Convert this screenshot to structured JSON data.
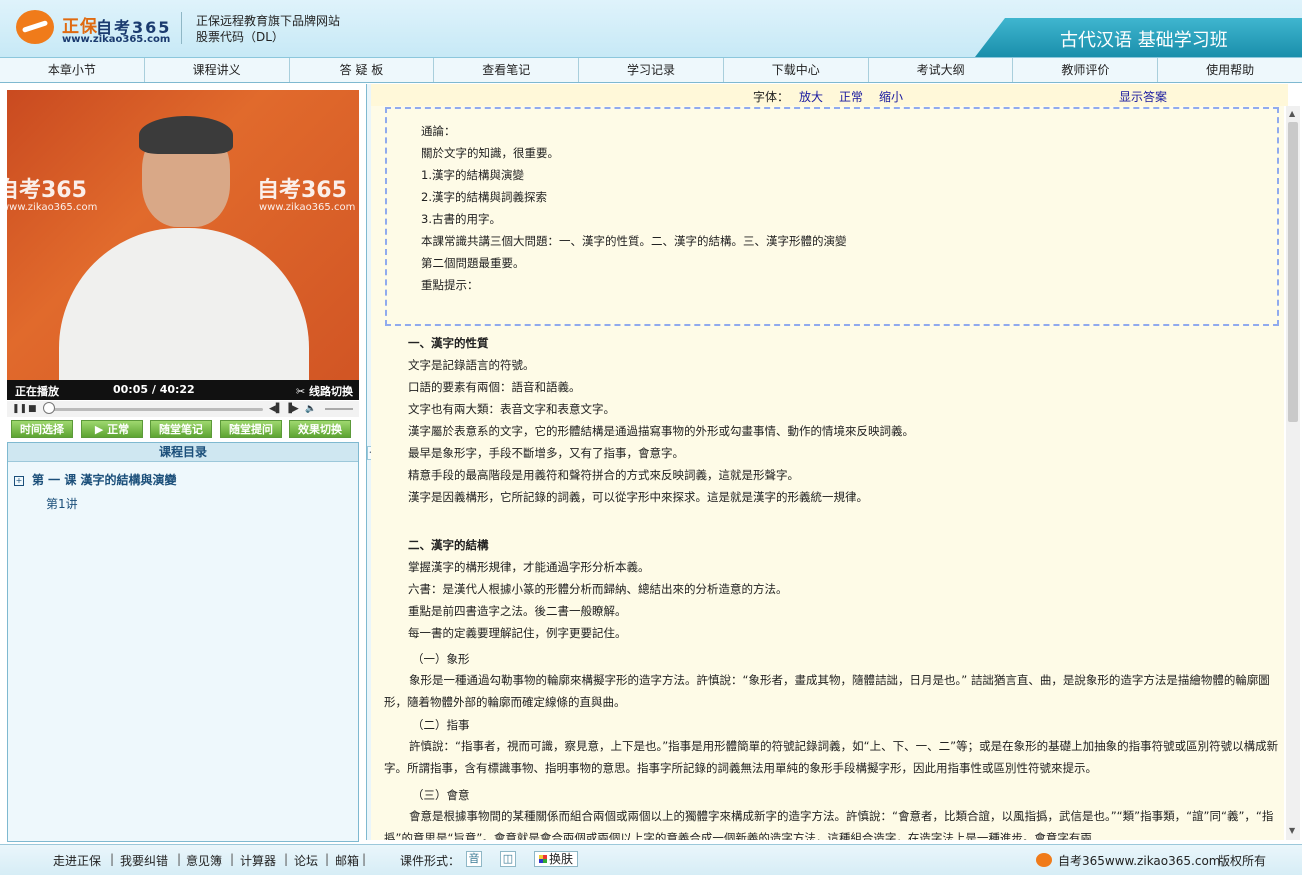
{
  "header": {
    "logo_cn": "正保",
    "logo_num": "自考365",
    "logo_url": "www.zikao365.com",
    "brand_line1": "正保远程教育旗下品牌网站",
    "brand_line2": "股票代码（DL）",
    "course_title": "古代汉语 基础学习班"
  },
  "nav": [
    "本章小节",
    "课程讲义",
    "答 疑 板",
    "查看笔记",
    "学习记录",
    "下载中心",
    "考试大纲",
    "教师评价",
    "使用帮助"
  ],
  "video": {
    "watermark": "自考365",
    "watermark_url": "www.zikao365.com",
    "status": "正在播放",
    "time": "00:05 / 40:22",
    "switch_line": "线路切换",
    "progress": 0.002
  },
  "func_buttons": [
    "时间选择",
    "▶ 正常",
    "随堂笔记",
    "随堂提问",
    "效果切换"
  ],
  "catalog": {
    "title": "课程目录",
    "lesson_toggle": "+",
    "lesson": "第 一 课 漢字的結構與演變",
    "item": "第1讲"
  },
  "content_top": {
    "font_label": "字体：",
    "enlarge": "放大",
    "normal": "正常",
    "shrink": "缩小",
    "show_answer": "显示答案"
  },
  "notes": [
    "通論：",
    "關於文字的知識，很重要。",
    "1.漢字的結構與演變",
    "2.漢字的結構與詞義探索",
    "3.古書的用字。",
    "本課常識共講三個大問題：一、漢字的性質。二、漢字的結構。三、漢字形體的演變",
    "第二個問題最重要。",
    "重點提示："
  ],
  "section1": {
    "heading": "一、漢字的性質",
    "lines": [
      "文字是記錄語言的符號。",
      "口語的要素有兩個：語音和語義。",
      "文字也有兩大類：表音文字和表意文字。",
      "漢字屬於表意系的文字，它的形體結構是通過描寫事物的外形或勾畫事情、動作的情境來反映詞義。",
      "最早是象形字，手段不斷增多，又有了指事，會意字。",
      "精意手段的最高階段是用義符和聲符拼合的方式來反映詞義，這就是形聲字。",
      "漢字是因義構形，它所記錄的詞義，可以從字形中來探求。這是就是漢字的形義統一規律。"
    ]
  },
  "section2": {
    "heading": "二、漢字的結構",
    "lines": [
      "掌握漢字的構形規律，才能通過字形分析本義。",
      "六書：是漢代人根據小篆的形體分析而歸納、總結出來的分析造意的方法。",
      "重點是前四書造字之法。後二書一般瞭解。",
      "每一書的定義要理解記住，例字更要記住。"
    ],
    "sub1": "（一）象形",
    "para1": "象形是一種通過勾勒事物的輪廓來構擬字形的造字方法。許慎說：“象形者，畫成其物，隨體詰詘，日月是也。” 詰詘猶言直、曲，是說象形的造字方法是描繪物體的輪廓圖形，隨着物體外部的輪廓而確定線條的直與曲。",
    "sub2": "（二）指事",
    "para2": "許慎說：“指事者，視而可識，察見意，上下是也。”指事是用形體簡單的符號記錄詞義，如“上、下、一、二”等；或是在象形的基礎上加抽象的指事符號或區別符號以構成新字。所謂指事，含有標識事物、指明事物的意思。指事字所記錄的詞義無法用單純的象形手段構擬字形，因此用指事性或區別性符號來提示。",
    "sub3": "（三）會意",
    "para3": "會意是根據事物間的某種關係而組合兩個或兩個以上的獨體字來構成新字的造字方法。許慎說：“會意者，比類合誼，以風指撝，武信是也。”“類”指事類，“誼”同“義”，“指撝”的意思是“旨意”。會意就是會合兩個或兩個以上字的意義合成一個新義的造字方法，這種組合造字，在造字法上是一種進步。會意字有兩"
  },
  "footer": {
    "links": [
      "走进正保",
      "我要纠错",
      "意见簿",
      "计算器",
      "论坛",
      "邮箱"
    ],
    "form_label": "课件形式：",
    "form_btn1": "音",
    "form_btn2": "◫",
    "skin": "换肤",
    "site": "自考365www.zikao365.com",
    "rights": "版权所有"
  }
}
